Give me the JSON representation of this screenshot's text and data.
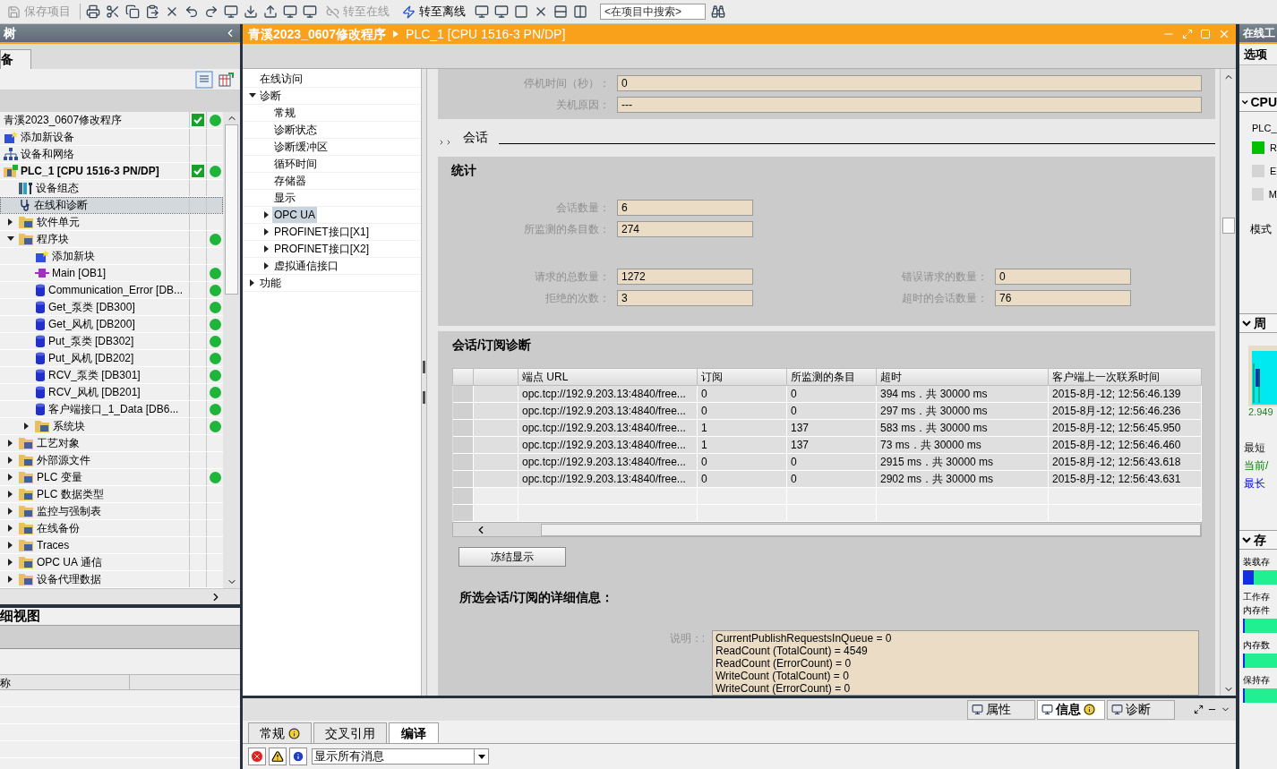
{
  "toolbar": {
    "save": {
      "label": "保存项目",
      "disabled": true
    },
    "go_online": {
      "label": "转至在线",
      "disabled": true
    },
    "go_offline": {
      "label": "转至离线",
      "disabled": false
    },
    "search": {
      "placeholder": "<在项目中搜索>"
    }
  },
  "project_tree": {
    "title": "树",
    "tab": "备",
    "items": [
      {
        "label": "青溪2023_0607修改程序",
        "kind": "none",
        "compare_ok": true,
        "online_ok": true,
        "selected": false
      },
      {
        "label": "添加新设备",
        "kind": "add",
        "compare_ok": false,
        "online_ok": false,
        "selected": false
      },
      {
        "label": "设备和网络",
        "kind": "network",
        "compare_ok": false,
        "online_ok": false,
        "selected": false
      },
      {
        "label": "PLC_1 [CPU 1516-3 PN/DP]",
        "kind": "plc",
        "compare_ok": true,
        "online_ok": true,
        "selected": false,
        "children": [
          {
            "label": "设备组态",
            "kind": "config",
            "compare_ok": false,
            "online_ok": false,
            "selected": false
          },
          {
            "label": "在线和诊断",
            "kind": "diag",
            "compare_ok": false,
            "online_ok": false,
            "selected": true
          },
          {
            "label": "软件单元",
            "kind": "folder",
            "expanded": false,
            "compare_ok": false,
            "online_ok": false,
            "selected": false
          },
          {
            "label": "程序块",
            "kind": "folder",
            "expanded": true,
            "compare_ok": false,
            "online_ok": true,
            "selected": false,
            "children": [
              {
                "label": "添加新块",
                "kind": "add",
                "compare_ok": false,
                "online_ok": false,
                "selected": false
              },
              {
                "label": "Main [OB1]",
                "kind": "ob",
                "compare_ok": false,
                "online_ok": true,
                "selected": false
              },
              {
                "label": "Communication_Error [DB...",
                "kind": "db",
                "compare_ok": false,
                "online_ok": true,
                "selected": false
              },
              {
                "label": "Get_泵类 [DB300]",
                "kind": "db",
                "compare_ok": false,
                "online_ok": true,
                "selected": false
              },
              {
                "label": "Get_风机 [DB200]",
                "kind": "db",
                "compare_ok": false,
                "online_ok": true,
                "selected": false
              },
              {
                "label": "Put_泵类 [DB302]",
                "kind": "db",
                "compare_ok": false,
                "online_ok": true,
                "selected": false
              },
              {
                "label": "Put_风机 [DB202]",
                "kind": "db",
                "compare_ok": false,
                "online_ok": true,
                "selected": false
              },
              {
                "label": "RCV_泵类 [DB301]",
                "kind": "db",
                "compare_ok": false,
                "online_ok": true,
                "selected": false
              },
              {
                "label": "RCV_风机 [DB201]",
                "kind": "db",
                "compare_ok": false,
                "online_ok": true,
                "selected": false
              },
              {
                "label": "客户端接口_1_Data [DB6...",
                "kind": "db",
                "compare_ok": false,
                "online_ok": true,
                "selected": false
              },
              {
                "label": "系统块",
                "kind": "folder",
                "expanded": false,
                "compare_ok": false,
                "online_ok": true,
                "selected": false
              }
            ]
          },
          {
            "label": "工艺对象",
            "kind": "folder",
            "expanded": false,
            "compare_ok": false,
            "online_ok": false,
            "selected": false
          },
          {
            "label": "外部源文件",
            "kind": "folder",
            "expanded": false,
            "compare_ok": false,
            "online_ok": false,
            "selected": false
          },
          {
            "label": "PLC 变量",
            "kind": "folder",
            "expanded": false,
            "compare_ok": false,
            "online_ok": true,
            "selected": false
          },
          {
            "label": "PLC 数据类型",
            "kind": "folder",
            "expanded": false,
            "compare_ok": false,
            "online_ok": false,
            "selected": false
          },
          {
            "label": "监控与强制表",
            "kind": "folder",
            "expanded": false,
            "compare_ok": false,
            "online_ok": false,
            "selected": false
          },
          {
            "label": "在线备份",
            "kind": "folder",
            "expanded": false,
            "compare_ok": false,
            "online_ok": false,
            "selected": false
          },
          {
            "label": "Traces",
            "kind": "folder",
            "expanded": false,
            "compare_ok": false,
            "online_ok": false,
            "selected": false
          },
          {
            "label": "OPC UA 通信",
            "kind": "folder",
            "expanded": false,
            "compare_ok": false,
            "online_ok": false,
            "selected": false
          },
          {
            "label": "设备代理数据",
            "kind": "folder",
            "expanded": false,
            "compare_ok": false,
            "online_ok": false,
            "selected": false
          }
        ]
      }
    ]
  },
  "details_view": {
    "title": "细视图",
    "column": "称"
  },
  "editor": {
    "path": [
      "青溪2023_0607修改程序",
      "PLC_1 [CPU 1516-3 PN/DP]"
    ],
    "nav": [
      {
        "label": "在线访问",
        "selected": false
      },
      {
        "label": "诊断",
        "expanded": true,
        "selected": false,
        "children": [
          {
            "label": "常规",
            "selected": false
          },
          {
            "label": "诊断状态",
            "selected": false
          },
          {
            "label": "诊断缓冲区",
            "selected": false
          },
          {
            "label": "循环时间",
            "selected": false
          },
          {
            "label": "存储器",
            "selected": false
          },
          {
            "label": "显示",
            "selected": false
          },
          {
            "label": "OPC UA",
            "expanded": false,
            "selected": true
          },
          {
            "label": "PROFINET接口[X1]",
            "expanded": false,
            "selected": false
          },
          {
            "label": "PROFINET接口[X2]",
            "expanded": false,
            "selected": false
          },
          {
            "label": "虚拟通信接口",
            "expanded": false,
            "selected": false
          }
        ]
      },
      {
        "label": "功能",
        "expanded": false,
        "selected": false
      }
    ],
    "top_fields": [
      {
        "label": "停机时间（秒）：",
        "value": "0"
      },
      {
        "label": "关机原因：",
        "value": "---"
      }
    ],
    "section": "会话",
    "stats": {
      "title": "统计",
      "left": [
        {
          "label": "会话数量：",
          "value": "6"
        },
        {
          "label": "所监测的条目数：",
          "value": "274"
        }
      ],
      "bottom_left": [
        {
          "label": "请求的总数量：",
          "value": "1272"
        },
        {
          "label": "拒绝的次数：",
          "value": "3"
        }
      ],
      "bottom_right": [
        {
          "label": "错误请求的数量：",
          "value": "0"
        },
        {
          "label": "超时的会话数量：",
          "value": "76"
        }
      ]
    },
    "sessions": {
      "title": "会话/订阅诊断",
      "columns": [
        "端点 URL",
        "订阅",
        "所监测的条目",
        "超时",
        "客户端上一次联系时间"
      ],
      "rows": [
        [
          "opc.tcp://192.9.203.13:4840/free...",
          "0",
          "0",
          "394 ms．共 30000 ms",
          "2015-8月-12; 12:56:46.139"
        ],
        [
          "opc.tcp://192.9.203.13:4840/free...",
          "0",
          "0",
          "297 ms．共 30000 ms",
          "2015-8月-12; 12:56:46.236"
        ],
        [
          "opc.tcp://192.9.203.13:4840/free...",
          "1",
          "137",
          "583 ms．共 30000 ms",
          "2015-8月-12; 12:56:45.950"
        ],
        [
          "opc.tcp://192.9.203.13:4840/free...",
          "1",
          "137",
          "73 ms．共 30000 ms",
          "2015-8月-12; 12:56:46.460"
        ],
        [
          "opc.tcp://192.9.203.13:4840/free...",
          "0",
          "0",
          "2915 ms．共 30000 ms",
          "2015-8月-12; 12:56:43.618"
        ],
        [
          "opc.tcp://192.9.203.13:4840/free...",
          "0",
          "0",
          "2902 ms．共 30000 ms",
          "2015-8月-12; 12:56:43.631"
        ]
      ],
      "freeze_button": "冻结显示",
      "details_title": "所选会话/订阅的详细信息：",
      "description_label": "说明：:",
      "description_lines": [
        "CurrentPublishRequestsInQueue = 0",
        "ReadCount (TotalCount) = 4549",
        "ReadCount (ErrorCount) = 0",
        "WriteCount (TotalCount) = 0",
        "WriteCount (ErrorCount) = 0"
      ]
    }
  },
  "inspector": {
    "view_tabs": [
      {
        "label": "属性",
        "selected": false,
        "info": false
      },
      {
        "label": "信息",
        "selected": true,
        "info": true
      },
      {
        "label": "诊断",
        "selected": false,
        "info": false
      }
    ],
    "tabs": [
      {
        "label": "常规",
        "selected": false,
        "info": true
      },
      {
        "label": "交叉引用",
        "selected": false,
        "info": false
      },
      {
        "label": "编译",
        "selected": true,
        "info": false
      }
    ],
    "filter": "显示所有消息"
  },
  "right_panel": {
    "title": "在线工",
    "options": "选项",
    "cpu": {
      "title": "CPU",
      "expanded": true,
      "name": "PLC_",
      "leds": [
        {
          "label": "R",
          "on": true
        },
        {
          "label": "E",
          "on": false
        },
        {
          "label": "M",
          "on": false
        }
      ],
      "mode": "模式"
    },
    "cycle": {
      "title": "周",
      "expanded": true,
      "reading": "2.949",
      "legend": [
        {
          "label": "最短",
          "kind": "min"
        },
        {
          "label": "当前/",
          "kind": "current"
        },
        {
          "label": "最长",
          "kind": "max"
        }
      ]
    },
    "memory": {
      "title": "存",
      "expanded": true,
      "bars": [
        {
          "lines": [
            "装载存"
          ],
          "level": 0.2
        },
        {
          "lines": [
            "工作存",
            "内存件"
          ],
          "level": 0.03
        },
        {
          "lines": [
            "内存数"
          ],
          "level": 0.03
        },
        {
          "lines": [
            "保持存"
          ],
          "level": 0.03
        }
      ]
    }
  }
}
